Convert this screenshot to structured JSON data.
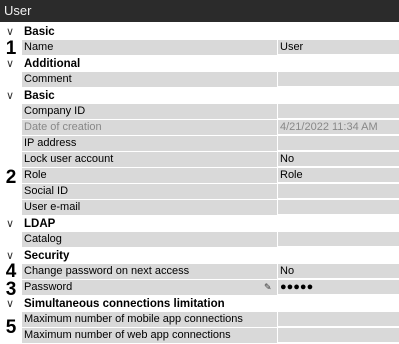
{
  "window": {
    "title": "User"
  },
  "groups": [
    {
      "name": "Basic",
      "properties": [
        {
          "name": "Name",
          "value": "User"
        }
      ]
    },
    {
      "name": "Additional",
      "properties": [
        {
          "name": "Comment",
          "value": ""
        }
      ]
    },
    {
      "name": "Basic",
      "properties": [
        {
          "name": "Company ID",
          "value": ""
        },
        {
          "name": "Date of creation",
          "value": "4/21/2022 11:34 AM",
          "readonly": true
        },
        {
          "name": "IP address",
          "value": ""
        },
        {
          "name": "Lock user account",
          "value": "No"
        },
        {
          "name": "Role",
          "value": "Role"
        },
        {
          "name": "Social ID",
          "value": ""
        },
        {
          "name": "User e-mail",
          "value": ""
        }
      ]
    },
    {
      "name": "LDAP",
      "properties": [
        {
          "name": "Catalog",
          "value": ""
        }
      ]
    },
    {
      "name": "Security",
      "properties": [
        {
          "name": "Change password on next access",
          "value": "No"
        },
        {
          "name": "Password",
          "value": "●●●●●",
          "edit_icon": "pencil-icon"
        }
      ]
    },
    {
      "name": "Simultaneous connections limitation",
      "properties": [
        {
          "name": "Maximum number of mobile app connections",
          "value": ""
        },
        {
          "name": "Maximum number of web app connections",
          "value": ""
        }
      ]
    }
  ],
  "markers": [
    "1",
    "2",
    "3",
    "4",
    "5"
  ]
}
